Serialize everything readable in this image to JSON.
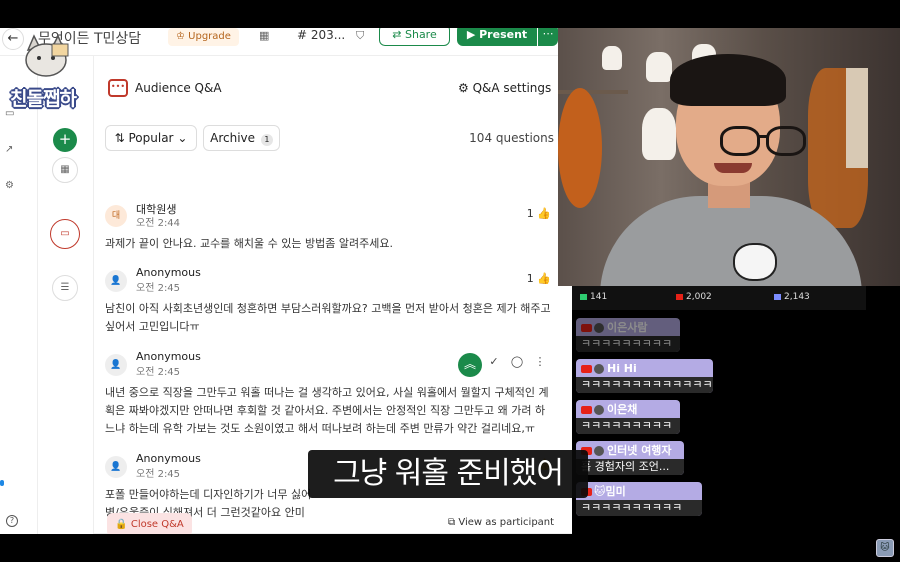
{
  "topbar": {
    "back_icon": "arrow-left-icon",
    "room_title": "무엇이든 T민상담",
    "upgrade_label": "Upgrade",
    "calendar_icon": "calendar-icon",
    "room_code": "203...",
    "shield_icon": "shield-icon",
    "share_label": "Share",
    "present_label": "Present",
    "more_icon": "more-vertical-icon"
  },
  "logo": {
    "text": "친돌쨉하"
  },
  "qa": {
    "header_title": "Audience Q&A",
    "settings_label": "Q&A settings",
    "sort_label": "Popular",
    "archive_label": "Archive",
    "archive_count": "1",
    "question_count": "104 questions",
    "questions": [
      {
        "name": "대학원생",
        "avatar": "대",
        "time": "오전 2:44",
        "likes": "1",
        "text": "과제가 끝이 안나요. 교수를 해치울 수 있는 방법좀 알려주세요."
      },
      {
        "name": "Anonymous",
        "avatar": "",
        "time": "오전 2:45",
        "likes": "1",
        "text": "남친이 아직 사회초년생인데 청혼하면 부담스러워할까요? 고백을 먼저 받아서 청혼은 제가 해주고 싶어서 고민입니다ㅠ"
      },
      {
        "name": "Anonymous",
        "avatar": "",
        "time": "오전 2:45",
        "likes": "",
        "text": "내년 중으로 직장을 그만두고 워홀 떠나는 걸 생각하고 있어요, 사실 워홀에서 뭘할지 구체적인 계획은 짜봐야겠지만 안떠나면 후회할 것 같아서요. 주변에서는 안정적인 직장 그만두고 왜 가려 하느냐 하는데 유학 가보는 것도 소원이였고 해서 떠나보려 하는데 주변 만류가 약간 걸리네요,ㅠ"
      },
      {
        "name": "Anonymous",
        "avatar": "",
        "time": "오전 2:45",
        "likes": "1",
        "text_line1": "포폴 만들어야하는데 디자인하기가 너무 싫어",
        "text_line2": "병/우울증이 심해져서 더 그런것같아요 안미"
      }
    ],
    "close_label": "Close Q&A",
    "view_participant_label": "View as participant"
  },
  "subtitle": "그냥 워홀 준비했어",
  "stream": {
    "stats": [
      {
        "label": "141",
        "color": "#2ecc71"
      },
      {
        "label": "2,002",
        "color": "#e62117"
      },
      {
        "label": "2,143",
        "color": "#7b8cff"
      }
    ],
    "messages": [
      {
        "user": "이은사람",
        "text": "ㅋㅋㅋㅋㅋㅋㅋㅋㅋ",
        "faded": true
      },
      {
        "user": "Hi Hi",
        "text": "ㅋㅋㅋㅋㅋㅋㅋㅋㅋㅋㅋㅋㅋ",
        "faded": false
      },
      {
        "user": "이은채",
        "text": "ㅋㅋㅋㅋㅋㅋㅋㅋㅋ",
        "faded": false
      },
      {
        "user": "인터넷 여행자",
        "text": "홀 경험자의 조언...",
        "faded": false
      },
      {
        "user": "🐱밈미",
        "text": "ㅋㅋㅋㅋㅋㅋㅋㅋㅋㅋ",
        "faded": false
      }
    ]
  },
  "colors": {
    "accent_green": "#1b8a4a",
    "brand_red": "#c0392b",
    "chat_purple": "#bdb4f0"
  }
}
